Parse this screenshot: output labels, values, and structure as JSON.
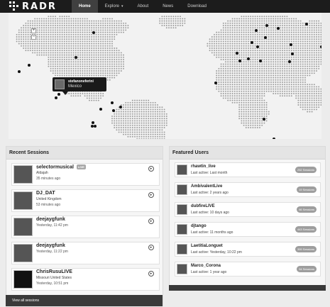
{
  "brand": {
    "name": "RADR"
  },
  "nav": [
    {
      "label": "Home",
      "active": true
    },
    {
      "label": "Explore",
      "caret": "▾"
    },
    {
      "label": "About"
    },
    {
      "label": "News"
    },
    {
      "label": "Download"
    }
  ],
  "map": {
    "zoom_in": "+",
    "zoom_out": "−",
    "tooltip": {
      "name": "stefanoneferini",
      "location": "Mexico"
    }
  },
  "recent": {
    "title": "Recent Sessions",
    "items": [
      {
        "name": "selectormusical",
        "live": "LIVE",
        "sub": "Aldajah",
        "time": "35 minutes ago"
      },
      {
        "name": "DJ_DAT",
        "sub": "United Kingdom",
        "time": "53 minutes ago"
      },
      {
        "name": "deejaygfunk",
        "sub": "",
        "time": "Yesterday, 11:42 pm"
      },
      {
        "name": "deejaygfunk",
        "sub": "",
        "time": "Yesterday, 11:22 pm"
      },
      {
        "name": "ChrisRusuLIVE",
        "sub": "Missouri United States",
        "time": "Yesterday, 10:51 pm"
      }
    ],
    "view_all": "View all sessions"
  },
  "featured": {
    "title": "Featured Users",
    "items": [
      {
        "name": "rhawtin_live",
        "sub": "Last active: Last month",
        "badge": "252 Sessions"
      },
      {
        "name": "AmbivalentLive",
        "sub": "Last active: 2 years ago",
        "badge": "19 Sessions"
      },
      {
        "name": "dubfireLIVE",
        "sub": "Last active: 10 days ago",
        "badge": "66 Sessions"
      },
      {
        "name": "djtango",
        "sub": "Last active: 11 months ago",
        "badge": "443 Sessions"
      },
      {
        "name": "LaetitiaLonguet",
        "sub": "Last active: Yesterday, 10:22 pm",
        "badge": "359 Sessions"
      },
      {
        "name": "Marco_Corona",
        "sub": "Last active: 1 year ago",
        "badge": "54 Sessions"
      }
    ]
  },
  "colors": {
    "topbar": "#1c1c1c",
    "map_dot": "#9a9a9a",
    "map_pin": "#111111",
    "badge": "#9e9e9e"
  },
  "icons": {
    "play": "play-circle-icon"
  }
}
